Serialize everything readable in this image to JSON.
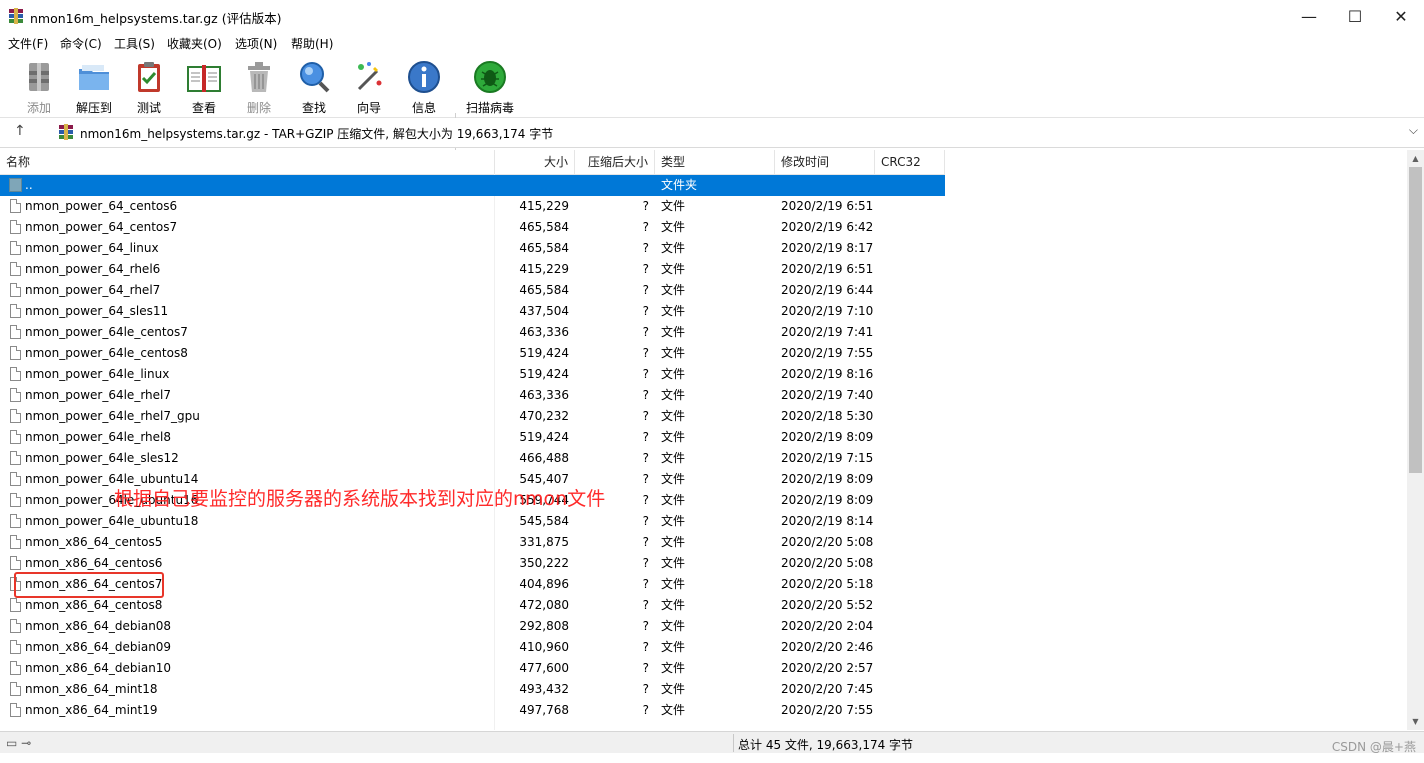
{
  "window": {
    "title": "nmon16m_helpsystems.tar.gz (评估版本)",
    "minimize": "—",
    "maximize": "☐",
    "close": "✕"
  },
  "menu": [
    {
      "label": "文件(F)"
    },
    {
      "label": "命令(C)"
    },
    {
      "label": "工具(S)"
    },
    {
      "label": "收藏夹(O)"
    },
    {
      "label": "选项(N)"
    },
    {
      "label": "帮助(H)"
    }
  ],
  "toolbar": [
    {
      "label": "添加",
      "icon": "add-archive-icon",
      "enabled": false
    },
    {
      "label": "解压到",
      "icon": "extract-folder-icon",
      "enabled": true
    },
    {
      "label": "测试",
      "icon": "test-clipboard-icon",
      "enabled": true
    },
    {
      "label": "查看",
      "icon": "view-book-icon",
      "enabled": true
    },
    {
      "label": "删除",
      "icon": "delete-trash-icon",
      "enabled": false
    },
    {
      "label": "查找",
      "icon": "find-magnifier-icon",
      "enabled": true
    },
    {
      "label": "向导",
      "icon": "wizard-wand-icon",
      "enabled": true
    },
    {
      "label": "信息",
      "icon": "info-icon",
      "enabled": true
    },
    {
      "label": "扫描病毒",
      "icon": "virus-scan-icon",
      "enabled": true
    }
  ],
  "address": {
    "text": "nmon16m_helpsystems.tar.gz - TAR+GZIP 压缩文件, 解包大小为 19,663,174 字节",
    "up": "↑",
    "dropdown": "⌵"
  },
  "columns": {
    "name": "名称",
    "size": "大小",
    "packed": "压缩后大小",
    "type": "类型",
    "mtime": "修改时间",
    "crc": "CRC32"
  },
  "rows": [
    {
      "name": "..",
      "size": "",
      "packed": "",
      "type": "文件夹",
      "mtime": "",
      "folder": true
    },
    {
      "name": "nmon_power_64_centos6",
      "size": "415,229",
      "packed": "?",
      "type": "文件",
      "mtime": "2020/2/19 6:51"
    },
    {
      "name": "nmon_power_64_centos7",
      "size": "465,584",
      "packed": "?",
      "type": "文件",
      "mtime": "2020/2/19 6:42"
    },
    {
      "name": "nmon_power_64_linux",
      "size": "465,584",
      "packed": "?",
      "type": "文件",
      "mtime": "2020/2/19 8:17"
    },
    {
      "name": "nmon_power_64_rhel6",
      "size": "415,229",
      "packed": "?",
      "type": "文件",
      "mtime": "2020/2/19 6:51"
    },
    {
      "name": "nmon_power_64_rhel7",
      "size": "465,584",
      "packed": "?",
      "type": "文件",
      "mtime": "2020/2/19 6:44"
    },
    {
      "name": "nmon_power_64_sles11",
      "size": "437,504",
      "packed": "?",
      "type": "文件",
      "mtime": "2020/2/19 7:10"
    },
    {
      "name": "nmon_power_64le_centos7",
      "size": "463,336",
      "packed": "?",
      "type": "文件",
      "mtime": "2020/2/19 7:41"
    },
    {
      "name": "nmon_power_64le_centos8",
      "size": "519,424",
      "packed": "?",
      "type": "文件",
      "mtime": "2020/2/19 7:55"
    },
    {
      "name": "nmon_power_64le_linux",
      "size": "519,424",
      "packed": "?",
      "type": "文件",
      "mtime": "2020/2/19 8:16"
    },
    {
      "name": "nmon_power_64le_rhel7",
      "size": "463,336",
      "packed": "?",
      "type": "文件",
      "mtime": "2020/2/19 7:40"
    },
    {
      "name": "nmon_power_64le_rhel7_gpu",
      "size": "470,232",
      "packed": "?",
      "type": "文件",
      "mtime": "2020/2/18 5:30"
    },
    {
      "name": "nmon_power_64le_rhel8",
      "size": "519,424",
      "packed": "?",
      "type": "文件",
      "mtime": "2020/2/19 8:09"
    },
    {
      "name": "nmon_power_64le_sles12",
      "size": "466,488",
      "packed": "?",
      "type": "文件",
      "mtime": "2020/2/19 7:15"
    },
    {
      "name": "nmon_power_64le_ubuntu14",
      "size": "545,407",
      "packed": "?",
      "type": "文件",
      "mtime": "2020/2/19 8:09"
    },
    {
      "name": "nmon_power_64le_ubuntu16",
      "size": "559,744",
      "packed": "?",
      "type": "文件",
      "mtime": "2020/2/19 8:09"
    },
    {
      "name": "nmon_power_64le_ubuntu18",
      "size": "545,584",
      "packed": "?",
      "type": "文件",
      "mtime": "2020/2/19 8:14"
    },
    {
      "name": "nmon_x86_64_centos5",
      "size": "331,875",
      "packed": "?",
      "type": "文件",
      "mtime": "2020/2/20 5:08"
    },
    {
      "name": "nmon_x86_64_centos6",
      "size": "350,222",
      "packed": "?",
      "type": "文件",
      "mtime": "2020/2/20 5:08"
    },
    {
      "name": "nmon_x86_64_centos7",
      "size": "404,896",
      "packed": "?",
      "type": "文件",
      "mtime": "2020/2/20 5:18"
    },
    {
      "name": "nmon_x86_64_centos8",
      "size": "472,080",
      "packed": "?",
      "type": "文件",
      "mtime": "2020/2/20 5:52"
    },
    {
      "name": "nmon_x86_64_debian08",
      "size": "292,808",
      "packed": "?",
      "type": "文件",
      "mtime": "2020/2/20 2:04"
    },
    {
      "name": "nmon_x86_64_debian09",
      "size": "410,960",
      "packed": "?",
      "type": "文件",
      "mtime": "2020/2/20 2:46"
    },
    {
      "name": "nmon_x86_64_debian10",
      "size": "477,600",
      "packed": "?",
      "type": "文件",
      "mtime": "2020/2/20 2:57"
    },
    {
      "name": "nmon_x86_64_mint18",
      "size": "493,432",
      "packed": "?",
      "type": "文件",
      "mtime": "2020/2/20 7:45"
    },
    {
      "name": "nmon_x86_64_mint19",
      "size": "497,768",
      "packed": "?",
      "type": "文件",
      "mtime": "2020/2/20 7:55"
    }
  ],
  "annotation": "根据自己要监控的服务器的系统版本找到对应的nmon文件",
  "status": {
    "total": "总计 45 文件, 19,663,174 字节",
    "icons": "▭ ⊸"
  },
  "watermark": "CSDN @晨+燕",
  "colors": {
    "selection": "#0078d7",
    "annotation": "#ff2a2a",
    "highlight": "#e8362a"
  }
}
